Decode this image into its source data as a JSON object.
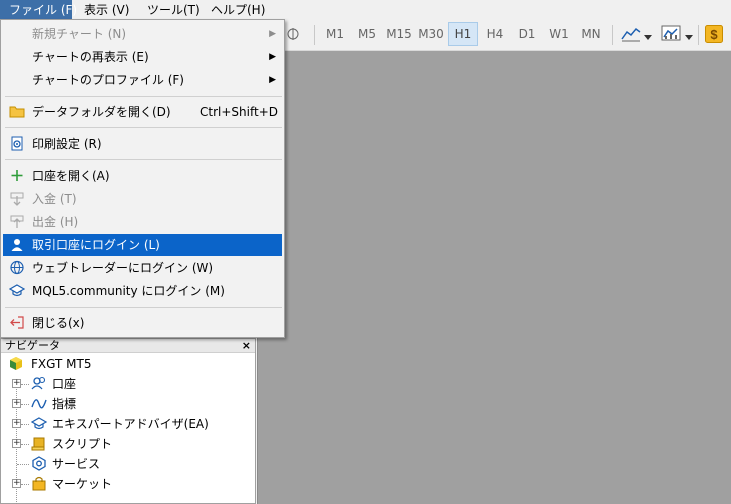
{
  "menubar": {
    "file": "ファイル (F)",
    "view": "表示 (V)",
    "tools": "ツール(T)",
    "help": "ヘルプ(H)"
  },
  "toolbar": {
    "timeframes": [
      "M1",
      "M5",
      "M15",
      "M30",
      "H1",
      "H4",
      "D1",
      "W1",
      "MN"
    ],
    "selected_timeframe": "H1"
  },
  "file_menu": {
    "new_chart": "新規チャート (N)",
    "reopen_chart": "チャートの再表示 (E)",
    "chart_profile": "チャートのプロファイル (F)",
    "open_data_folder": "データフォルダを開く(D)",
    "open_data_folder_shortcut": "Ctrl+Shift+D",
    "print_setup": "印刷設定 (R)",
    "open_account": "口座を開く(A)",
    "deposit": "入金 (T)",
    "withdraw": "出金 (H)",
    "login_trade_account": "取引口座にログイン (L)",
    "login_web_trader": "ウェブトレーダーにログイン (W)",
    "login_mql5": "MQL5.community にログイン (M)",
    "close": "閉じる(x)"
  },
  "navigator": {
    "title": "ナビゲータ",
    "close": "×",
    "root": "FXGT MT5",
    "items": [
      "口座",
      "指標",
      "エキスパートアドバイザ(EA)",
      "スクリプト",
      "サービス",
      "マーケット"
    ]
  },
  "colors": {
    "highlight": "#0b64c9",
    "chart_background": "#a0a0a0",
    "active_menu": "#3d6fa8"
  }
}
